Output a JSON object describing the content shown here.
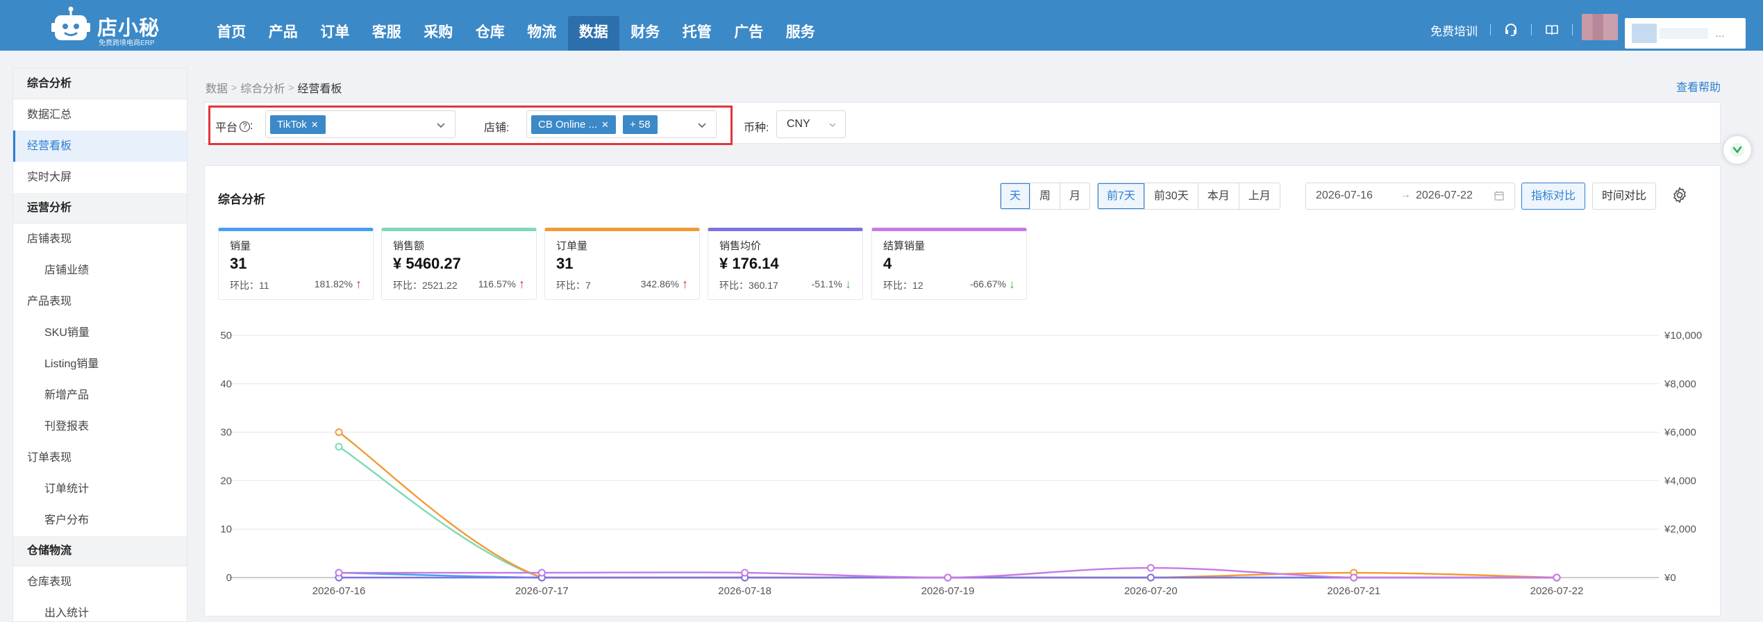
{
  "brand": {
    "name": "店小秘",
    "tagline": "免费跨境电商ERP"
  },
  "nav": [
    {
      "label": "首页"
    },
    {
      "label": "产品"
    },
    {
      "label": "订单"
    },
    {
      "label": "客服"
    },
    {
      "label": "采购"
    },
    {
      "label": "仓库"
    },
    {
      "label": "物流"
    },
    {
      "label": "数据"
    },
    {
      "label": "财务"
    },
    {
      "label": "托管"
    },
    {
      "label": "广告"
    },
    {
      "label": "服务"
    }
  ],
  "nav_active": "数据",
  "top_right": {
    "training": "免费培训"
  },
  "sidebar": [
    {
      "label": "综合分析",
      "kind": "group"
    },
    {
      "label": "数据汇总",
      "kind": "item"
    },
    {
      "label": "经营看板",
      "kind": "item",
      "active": true
    },
    {
      "label": "实时大屏",
      "kind": "item"
    },
    {
      "label": "运营分析",
      "kind": "group"
    },
    {
      "label": "店铺表现",
      "kind": "item"
    },
    {
      "label": "店铺业绩",
      "kind": "sub"
    },
    {
      "label": "产品表现",
      "kind": "item"
    },
    {
      "label": "SKU销量",
      "kind": "sub"
    },
    {
      "label": "Listing销量",
      "kind": "sub"
    },
    {
      "label": "新增产品",
      "kind": "sub"
    },
    {
      "label": "刊登报表",
      "kind": "sub"
    },
    {
      "label": "订单表现",
      "kind": "item"
    },
    {
      "label": "订单统计",
      "kind": "sub"
    },
    {
      "label": "客户分布",
      "kind": "sub"
    },
    {
      "label": "仓储物流",
      "kind": "group"
    },
    {
      "label": "仓库表现",
      "kind": "item"
    },
    {
      "label": "出入统计",
      "kind": "sub"
    }
  ],
  "breadcrumb": [
    "数据",
    "综合分析",
    "经营看板"
  ],
  "help_link": "查看帮助",
  "filters": {
    "platform_label": "平台",
    "platform_tag": "TikTok",
    "shop_label": "店铺:",
    "shop_tag": "CB Online ...",
    "shop_more": "+ 58",
    "currency_label": "币种:",
    "currency_value": "CNY"
  },
  "section_title": "综合分析",
  "granularity": [
    "天",
    "周",
    "月"
  ],
  "granularity_active": "天",
  "periods": [
    "前7天",
    "前30天",
    "本月",
    "上月"
  ],
  "period_active": "前7天",
  "date_range": {
    "start": "2026-07-16",
    "end": "2026-07-22"
  },
  "buttons": {
    "compare_metric": "指标对比",
    "compare_time": "时间对比"
  },
  "metrics": [
    {
      "title": "销量",
      "value": "31",
      "prev": "环比：11",
      "pct": "181.82%",
      "dir": "up",
      "color": "#46a0f0"
    },
    {
      "title": "销售额",
      "value": "¥ 5460.27",
      "prev": "环比：2521.22",
      "pct": "116.57%",
      "dir": "up",
      "color": "#7fd9b5"
    },
    {
      "title": "订单量",
      "value": "31",
      "prev": "环比：7",
      "pct": "342.86%",
      "dir": "up",
      "color": "#f39a35"
    },
    {
      "title": "销售均价",
      "value": "¥ 176.14",
      "prev": "环比：360.17",
      "pct": "-51.1%",
      "dir": "down",
      "color": "#7b74e0"
    },
    {
      "title": "结算销量",
      "value": "4",
      "prev": "环比：12",
      "pct": "-66.67%",
      "dir": "down",
      "color": "#c77ae6"
    }
  ],
  "chart_data": {
    "type": "line",
    "x": [
      "2026-07-16",
      "2026-07-17",
      "2026-07-18",
      "2026-07-19",
      "2026-07-20",
      "2026-07-21",
      "2026-07-22"
    ],
    "y_left": {
      "ticks": [
        0,
        10,
        20,
        30,
        40,
        50
      ],
      "ylim": [
        0,
        50
      ]
    },
    "y_right": {
      "ticks": [
        "¥0",
        "¥2,000",
        "¥4,000",
        "¥6,000",
        "¥8,000",
        "¥10,000"
      ],
      "ylim": [
        0,
        10000
      ]
    },
    "grid": true,
    "series": [
      {
        "color": "#46a0f0",
        "axis": "left",
        "values": [
          1,
          0,
          0,
          0,
          0,
          0,
          0
        ]
      },
      {
        "color": "#7fd9b5",
        "axis": "right",
        "values": [
          5400,
          0,
          0,
          0,
          0,
          0,
          0
        ]
      },
      {
        "color": "#f39a35",
        "axis": "left",
        "values": [
          30,
          0,
          0,
          0,
          0,
          1,
          0
        ]
      },
      {
        "color": "#7b74e0",
        "axis": "left",
        "values": [
          0,
          0,
          0,
          0,
          0,
          0,
          0
        ]
      },
      {
        "color": "#c77ae6",
        "axis": "left",
        "values": [
          1,
          1,
          1,
          0,
          2,
          0,
          0
        ]
      }
    ]
  }
}
